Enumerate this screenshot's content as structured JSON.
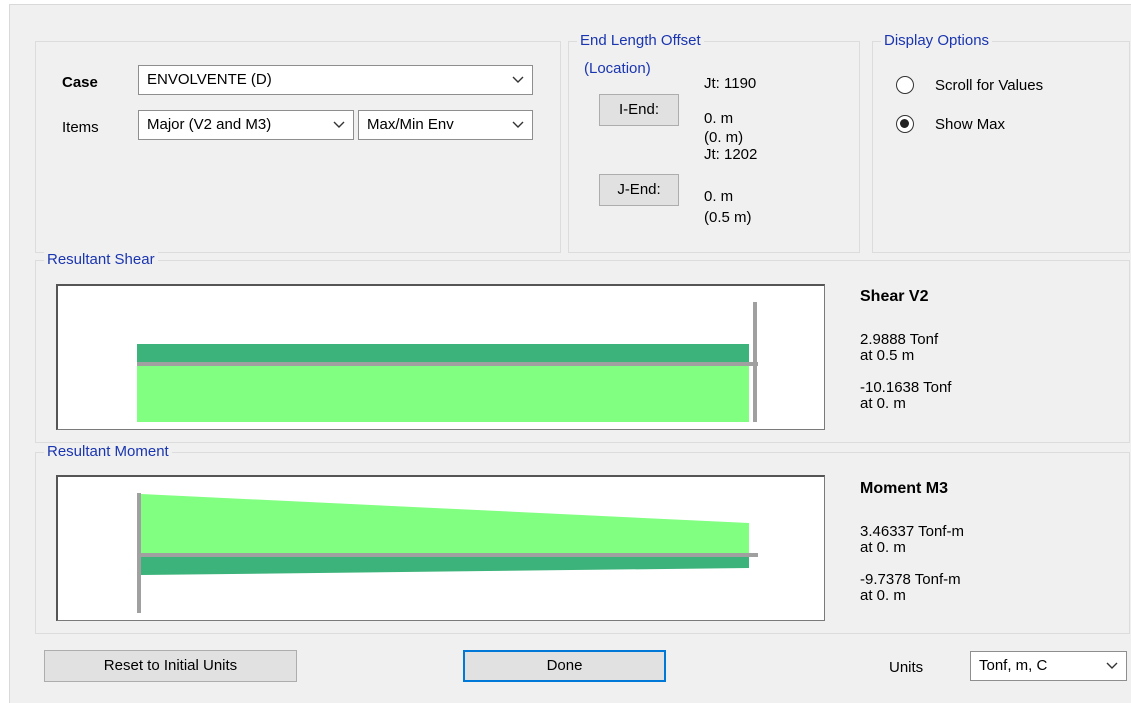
{
  "case": {
    "label": "Case",
    "value": "ENVOLVENTE (D)"
  },
  "items": {
    "label": "Items",
    "component": "Major (V2 and M3)",
    "envelope": "Max/Min Env"
  },
  "end_length_offset": {
    "title": "End Length Offset",
    "subtitle": "(Location)",
    "i_end": {
      "button": "I-End:",
      "joint": "Jt:  1190",
      "offset": "0. m",
      "location": "(0. m)"
    },
    "j_end": {
      "button": "J-End:",
      "joint": "Jt:  1202",
      "offset": "0. m",
      "location": "(0.5 m)"
    }
  },
  "display_options": {
    "title": "Display Options",
    "options": [
      {
        "label": "Scroll for Values",
        "selected": false
      },
      {
        "label": "Show Max",
        "selected": true
      }
    ]
  },
  "shear": {
    "group_title": "Resultant Shear",
    "heading": "Shear V2",
    "max_value": "2.9888 Tonf",
    "max_at": "at 0.5 m",
    "min_value": "-10.1638 Tonf",
    "min_at": "at 0. m"
  },
  "moment": {
    "group_title": "Resultant Moment",
    "heading": "Moment M3",
    "max_value": "3.46337 Tonf-m",
    "max_at": "at 0. m",
    "min_value": "-9.7378 Tonf-m",
    "min_at": "at 0. m"
  },
  "footer": {
    "reset_label": "Reset to Initial Units",
    "done_label": "Done",
    "units_label": "Units",
    "units_value": "Tonf, m, C"
  },
  "colors": {
    "positive_fill": "#3cb37a",
    "negative_fill": "#80ff80",
    "axis": "#a0a0a0",
    "legend_text": "#1a35b0",
    "default_button_border": "#0078d7"
  }
}
